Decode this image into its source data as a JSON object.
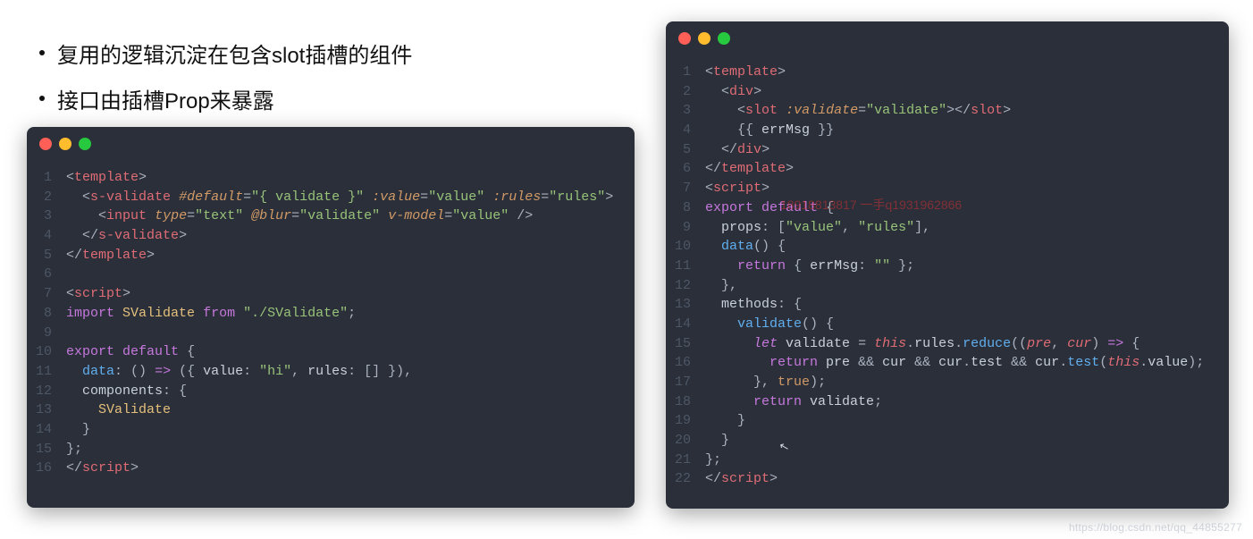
{
  "bullets": [
    "复用的逻辑沉淀在包含slot插槽的组件",
    "接口由插槽Prop来暴露"
  ],
  "left_code": {
    "line_count": 16,
    "tokens": [
      [
        [
          "t-punc",
          "<"
        ],
        [
          "t-tag",
          "template"
        ],
        [
          "t-punc",
          ">"
        ]
      ],
      [
        [
          "t-plain",
          "  "
        ],
        [
          "t-punc",
          "<"
        ],
        [
          "t-tag",
          "s-validate"
        ],
        [
          "t-plain",
          " "
        ],
        [
          "t-attr",
          "#default"
        ],
        [
          "t-punc",
          "="
        ],
        [
          "t-str",
          "\"{ validate }\""
        ],
        [
          "t-plain",
          " "
        ],
        [
          "t-attr",
          ":value"
        ],
        [
          "t-punc",
          "="
        ],
        [
          "t-str",
          "\"value\""
        ],
        [
          "t-plain",
          " "
        ],
        [
          "t-attr",
          ":rules"
        ],
        [
          "t-punc",
          "="
        ],
        [
          "t-str",
          "\"rules\""
        ],
        [
          "t-punc",
          ">"
        ]
      ],
      [
        [
          "t-plain",
          "    "
        ],
        [
          "t-punc",
          "<"
        ],
        [
          "t-tag",
          "input"
        ],
        [
          "t-plain",
          " "
        ],
        [
          "t-attr",
          "type"
        ],
        [
          "t-punc",
          "="
        ],
        [
          "t-str",
          "\"text\""
        ],
        [
          "t-plain",
          " "
        ],
        [
          "t-attr",
          "@blur"
        ],
        [
          "t-punc",
          "="
        ],
        [
          "t-str",
          "\"validate\""
        ],
        [
          "t-plain",
          " "
        ],
        [
          "t-attr",
          "v-model"
        ],
        [
          "t-punc",
          "="
        ],
        [
          "t-str",
          "\"value\""
        ],
        [
          "t-plain",
          " "
        ],
        [
          "t-punc",
          "/>"
        ]
      ],
      [
        [
          "t-plain",
          "  "
        ],
        [
          "t-punc",
          "</"
        ],
        [
          "t-tag",
          "s-validate"
        ],
        [
          "t-punc",
          ">"
        ]
      ],
      [
        [
          "t-punc",
          "</"
        ],
        [
          "t-tag",
          "template"
        ],
        [
          "t-punc",
          ">"
        ]
      ],
      [],
      [
        [
          "t-punc",
          "<"
        ],
        [
          "t-tag",
          "script"
        ],
        [
          "t-punc",
          ">"
        ]
      ],
      [
        [
          "t-kw",
          "import"
        ],
        [
          "t-plain",
          " "
        ],
        [
          "t-ident",
          "SValidate"
        ],
        [
          "t-plain",
          " "
        ],
        [
          "t-kw",
          "from"
        ],
        [
          "t-plain",
          " "
        ],
        [
          "t-str",
          "\"./SValidate\""
        ],
        [
          "t-punc",
          ";"
        ]
      ],
      [],
      [
        [
          "t-kw",
          "export"
        ],
        [
          "t-plain",
          " "
        ],
        [
          "t-kw",
          "default"
        ],
        [
          "t-plain",
          " "
        ],
        [
          "t-punc",
          "{"
        ]
      ],
      [
        [
          "t-plain",
          "  "
        ],
        [
          "t-fn",
          "data"
        ],
        [
          "t-punc",
          ": () "
        ],
        [
          "t-kw2",
          "=>"
        ],
        [
          "t-punc",
          " ({ "
        ],
        [
          "t-plain",
          "value"
        ],
        [
          "t-punc",
          ": "
        ],
        [
          "t-str",
          "\"hi\""
        ],
        [
          "t-punc",
          ", "
        ],
        [
          "t-plain",
          "rules"
        ],
        [
          "t-punc",
          ": [] }),"
        ]
      ],
      [
        [
          "t-plain",
          "  components"
        ],
        [
          "t-punc",
          ": {"
        ]
      ],
      [
        [
          "t-plain",
          "    "
        ],
        [
          "t-ident",
          "SValidate"
        ]
      ],
      [
        [
          "t-plain",
          "  "
        ],
        [
          "t-punc",
          "}"
        ]
      ],
      [
        [
          "t-punc",
          "};"
        ]
      ],
      [
        [
          "t-punc",
          "</"
        ],
        [
          "t-tag",
          "script"
        ],
        [
          "t-punc",
          ">"
        ]
      ]
    ]
  },
  "right_code": {
    "line_count": 22,
    "tokens": [
      [
        [
          "t-punc",
          "<"
        ],
        [
          "t-tag",
          "template"
        ],
        [
          "t-punc",
          ">"
        ]
      ],
      [
        [
          "t-plain",
          "  "
        ],
        [
          "t-punc",
          "<"
        ],
        [
          "t-tag",
          "div"
        ],
        [
          "t-punc",
          ">"
        ]
      ],
      [
        [
          "t-plain",
          "    "
        ],
        [
          "t-punc",
          "<"
        ],
        [
          "t-tag",
          "slot"
        ],
        [
          "t-plain",
          " "
        ],
        [
          "t-attr",
          ":validate"
        ],
        [
          "t-punc",
          "="
        ],
        [
          "t-str",
          "\"validate\""
        ],
        [
          "t-punc",
          "></"
        ],
        [
          "t-tag",
          "slot"
        ],
        [
          "t-punc",
          ">"
        ]
      ],
      [
        [
          "t-plain",
          "    "
        ],
        [
          "t-punc",
          "{{ "
        ],
        [
          "t-plain",
          "errMsg"
        ],
        [
          "t-punc",
          " }}"
        ]
      ],
      [
        [
          "t-plain",
          "  "
        ],
        [
          "t-punc",
          "</"
        ],
        [
          "t-tag",
          "div"
        ],
        [
          "t-punc",
          ">"
        ]
      ],
      [
        [
          "t-punc",
          "</"
        ],
        [
          "t-tag",
          "template"
        ],
        [
          "t-punc",
          ">"
        ]
      ],
      [
        [
          "t-punc",
          "<"
        ],
        [
          "t-tag",
          "script"
        ],
        [
          "t-punc",
          ">"
        ]
      ],
      [
        [
          "t-kw",
          "export"
        ],
        [
          "t-plain",
          " "
        ],
        [
          "t-kw",
          "default"
        ],
        [
          "t-plain",
          " "
        ],
        [
          "t-punc",
          "{"
        ]
      ],
      [
        [
          "t-plain",
          "  props"
        ],
        [
          "t-punc",
          ": ["
        ],
        [
          "t-str",
          "\"value\""
        ],
        [
          "t-punc",
          ", "
        ],
        [
          "t-str",
          "\"rules\""
        ],
        [
          "t-punc",
          "],"
        ]
      ],
      [
        [
          "t-plain",
          "  "
        ],
        [
          "t-fn",
          "data"
        ],
        [
          "t-punc",
          "() {"
        ]
      ],
      [
        [
          "t-plain",
          "    "
        ],
        [
          "t-kw",
          "return"
        ],
        [
          "t-plain",
          " "
        ],
        [
          "t-punc",
          "{ "
        ],
        [
          "t-plain",
          "errMsg"
        ],
        [
          "t-punc",
          ": "
        ],
        [
          "t-str",
          "\"\""
        ],
        [
          "t-punc",
          " };"
        ]
      ],
      [
        [
          "t-plain",
          "  "
        ],
        [
          "t-punc",
          "},"
        ]
      ],
      [
        [
          "t-plain",
          "  methods"
        ],
        [
          "t-punc",
          ": {"
        ]
      ],
      [
        [
          "t-plain",
          "    "
        ],
        [
          "t-fn",
          "validate"
        ],
        [
          "t-punc",
          "() {"
        ]
      ],
      [
        [
          "t-plain",
          "      "
        ],
        [
          "t-kw2",
          "let"
        ],
        [
          "t-plain",
          " validate "
        ],
        [
          "t-punc",
          "= "
        ],
        [
          "t-this",
          "this"
        ],
        [
          "t-punc",
          "."
        ],
        [
          "t-plain",
          "rules"
        ],
        [
          "t-punc",
          "."
        ],
        [
          "t-fn",
          "reduce"
        ],
        [
          "t-punc",
          "(("
        ],
        [
          "t-arg",
          "pre"
        ],
        [
          "t-punc",
          ", "
        ],
        [
          "t-arg",
          "cur"
        ],
        [
          "t-punc",
          ") "
        ],
        [
          "t-kw2",
          "=>"
        ],
        [
          "t-punc",
          " {"
        ]
      ],
      [
        [
          "t-plain",
          "        "
        ],
        [
          "t-kw",
          "return"
        ],
        [
          "t-plain",
          " pre "
        ],
        [
          "t-punc",
          "&&"
        ],
        [
          "t-plain",
          " cur "
        ],
        [
          "t-punc",
          "&&"
        ],
        [
          "t-plain",
          " cur"
        ],
        [
          "t-punc",
          "."
        ],
        [
          "t-plain",
          "test "
        ],
        [
          "t-punc",
          "&&"
        ],
        [
          "t-plain",
          " cur"
        ],
        [
          "t-punc",
          "."
        ],
        [
          "t-fn",
          "test"
        ],
        [
          "t-punc",
          "("
        ],
        [
          "t-this",
          "this"
        ],
        [
          "t-punc",
          "."
        ],
        [
          "t-plain",
          "value"
        ],
        [
          "t-punc",
          ");"
        ]
      ],
      [
        [
          "t-plain",
          "      "
        ],
        [
          "t-punc",
          "}, "
        ],
        [
          "t-bool",
          "true"
        ],
        [
          "t-punc",
          ");"
        ]
      ],
      [
        [
          "t-plain",
          "      "
        ],
        [
          "t-kw",
          "return"
        ],
        [
          "t-plain",
          " validate"
        ],
        [
          "t-punc",
          ";"
        ]
      ],
      [
        [
          "t-plain",
          "    "
        ],
        [
          "t-punc",
          "}"
        ]
      ],
      [
        [
          "t-plain",
          "  "
        ],
        [
          "t-punc",
          "}"
        ]
      ],
      [
        [
          "t-punc",
          "};"
        ]
      ],
      [
        [
          "t-punc",
          "</"
        ],
        [
          "t-tag",
          "script"
        ],
        [
          "t-punc",
          ">"
        ]
      ]
    ]
  },
  "overlay_text": "18918813817 一手q1931962866",
  "watermark": "https://blog.csdn.net/qq_44855277"
}
